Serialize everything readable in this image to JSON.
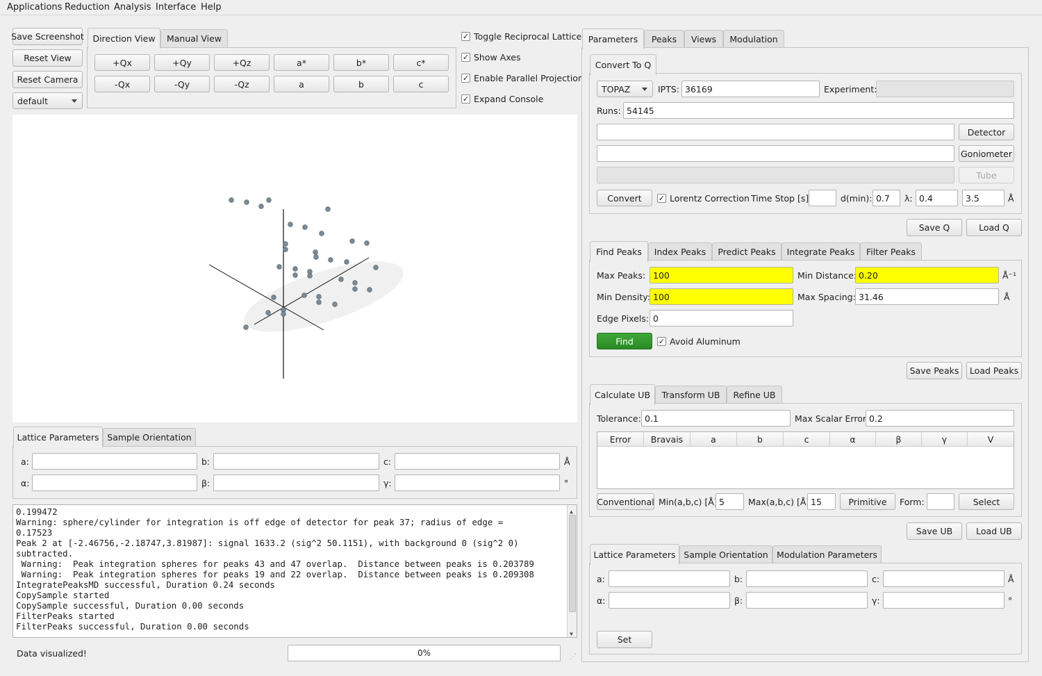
{
  "menu": [
    "Applications",
    "Reduction",
    "Analysis",
    "Interface",
    "Help"
  ],
  "left_buttons": {
    "save_screenshot": "Save Screenshot",
    "reset_view": "Reset View",
    "reset_camera": "Reset Camera",
    "camera_mode": "default"
  },
  "view_tabs": [
    "Direction View",
    "Manual View"
  ],
  "direction_buttons_row1": [
    "+Qx",
    "+Qy",
    "+Qz",
    "a*",
    "b*",
    "c*"
  ],
  "direction_buttons_row2": [
    "-Qx",
    "-Qy",
    "-Qz",
    "a",
    "b",
    "c"
  ],
  "view_options": [
    {
      "label": "Toggle Reciprocal Lattice",
      "checked": true
    },
    {
      "label": "Show Axes",
      "checked": true
    },
    {
      "label": "Enable Parallel Projection",
      "checked": true
    },
    {
      "label": "Expand Console",
      "checked": true
    }
  ],
  "left_lattice": {
    "tabs": [
      "Lattice Parameters",
      "Sample Orientation"
    ],
    "labels": {
      "a": "a:",
      "b": "b:",
      "c": "c:",
      "alpha": "α:",
      "beta": "β:",
      "gamma": "γ:",
      "length_unit": "Å",
      "angle_unit": "°"
    }
  },
  "console_lines": [
    "0.199472",
    "Warning: sphere/cylinder for integration is off edge of detector for peak 37; radius of edge =",
    "0.17523",
    "Peak 2 at [-2.46756,-2.18747,3.81987]: signal 1633.2 (sig^2 50.1151), with background 0 (sig^2 0)",
    "subtracted.",
    " Warning:  Peak integration spheres for peaks 43 and 47 overlap.  Distance between peaks is 0.203789",
    " Warning:  Peak integration spheres for peaks 19 and 22 overlap.  Distance between peaks is 0.209308",
    "IntegratePeaksMD successful, Duration 0.24 seconds",
    "CopySample started",
    "CopySample successful, Duration 0.00 seconds",
    "FilterPeaks started",
    "FilterPeaks successful, Duration 0.00 seconds"
  ],
  "status": {
    "message": "Data visualized!",
    "progress_text": "0%",
    "progress": 0
  },
  "right_tabs": [
    "Parameters",
    "Peaks",
    "Views",
    "Modulation"
  ],
  "convert": {
    "tab": "Convert To Q",
    "instrument": "TOPAZ",
    "ipts_label": "IPTS:",
    "ipts": "36169",
    "experiment_label": "Experiment:",
    "experiment": "",
    "runs_label": "Runs:",
    "runs": "54145",
    "detector_button": "Detector",
    "goniometer_button": "Goniometer",
    "tube_button": "Tube",
    "convert_button": "Convert",
    "lorentz_label": "Lorentz Correction",
    "lorentz_checked": true,
    "time_stop_label": "Time Stop [s]:",
    "time_stop": "",
    "dmin_label": "d(min):",
    "dmin": "0.7",
    "lambda_label": "λ:",
    "lambda_min": "0.4",
    "lambda_max": "3.5",
    "unit": "Å",
    "save_q": "Save Q",
    "load_q": "Load Q"
  },
  "peaks": {
    "tabs": [
      "Find Peaks",
      "Index Peaks",
      "Predict Peaks",
      "Integrate Peaks",
      "Filter Peaks"
    ],
    "max_peaks_label": "Max Peaks:",
    "max_peaks": "100",
    "min_distance_label": "Min Distance:",
    "min_distance": "0.20",
    "min_distance_unit": "Å⁻¹",
    "min_density_label": "Min Density:",
    "min_density": "100",
    "max_spacing_label": "Max Spacing:",
    "max_spacing": "31.46",
    "max_spacing_unit": "Å",
    "edge_pixels_label": "Edge Pixels:",
    "edge_pixels": "0",
    "find_button": "Find",
    "avoid_aluminum_label": "Avoid Aluminum",
    "avoid_aluminum_checked": true,
    "save_peaks": "Save Peaks",
    "load_peaks": "Load Peaks"
  },
  "ub": {
    "tabs": [
      "Calculate UB",
      "Transform UB",
      "Refine UB"
    ],
    "tolerance_label": "Tolerance:",
    "tolerance": "0.1",
    "max_scalar_error_label": "Max Scalar Error:",
    "max_scalar_error": "0.2",
    "columns": [
      "Error",
      "Bravais",
      "a",
      "b",
      "c",
      "α",
      "β",
      "γ",
      "V"
    ],
    "conventional_button": "Conventional",
    "min_abc_label": "Min(a,b,c) [Å]:",
    "min_abc": "5",
    "max_abc_label": "Max(a,b,c) [Å]:",
    "max_abc": "15",
    "primitive_button": "Primitive",
    "form_label": "Form:",
    "form": "",
    "select_button": "Select",
    "save_ub": "Save UB",
    "load_ub": "Load UB"
  },
  "right_lattice": {
    "tabs": [
      "Lattice Parameters",
      "Sample Orientation",
      "Modulation Parameters"
    ],
    "labels": {
      "a": "a:",
      "b": "b:",
      "c": "c:",
      "alpha": "α:",
      "beta": "β:",
      "gamma": "γ:",
      "length_unit": "Å",
      "angle_unit": "°"
    },
    "set_button": "Set"
  }
}
